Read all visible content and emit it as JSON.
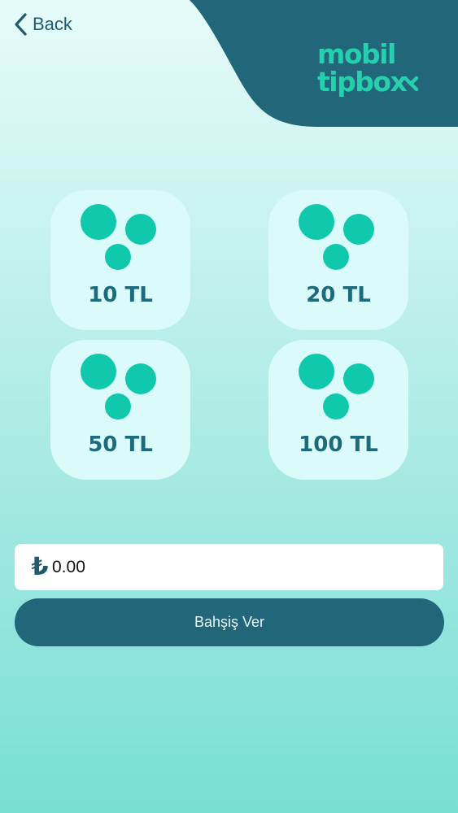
{
  "nav": {
    "back_label": "Back"
  },
  "logo": {
    "line1": "mobil",
    "line2": "tipbox"
  },
  "tip_options": [
    {
      "label": "10 TL"
    },
    {
      "label": "20 TL"
    },
    {
      "label": "50 TL"
    },
    {
      "label": "100 TL"
    }
  ],
  "amount": {
    "currency_symbol": "₺",
    "placeholder": "0.00"
  },
  "submit": {
    "label": "Bahşiş Ver"
  },
  "colors": {
    "header": "#226679",
    "accent": "#25d1ac",
    "coin": "#10c8ac",
    "card": "#dbfbfb",
    "text": "#1c6a7b"
  }
}
